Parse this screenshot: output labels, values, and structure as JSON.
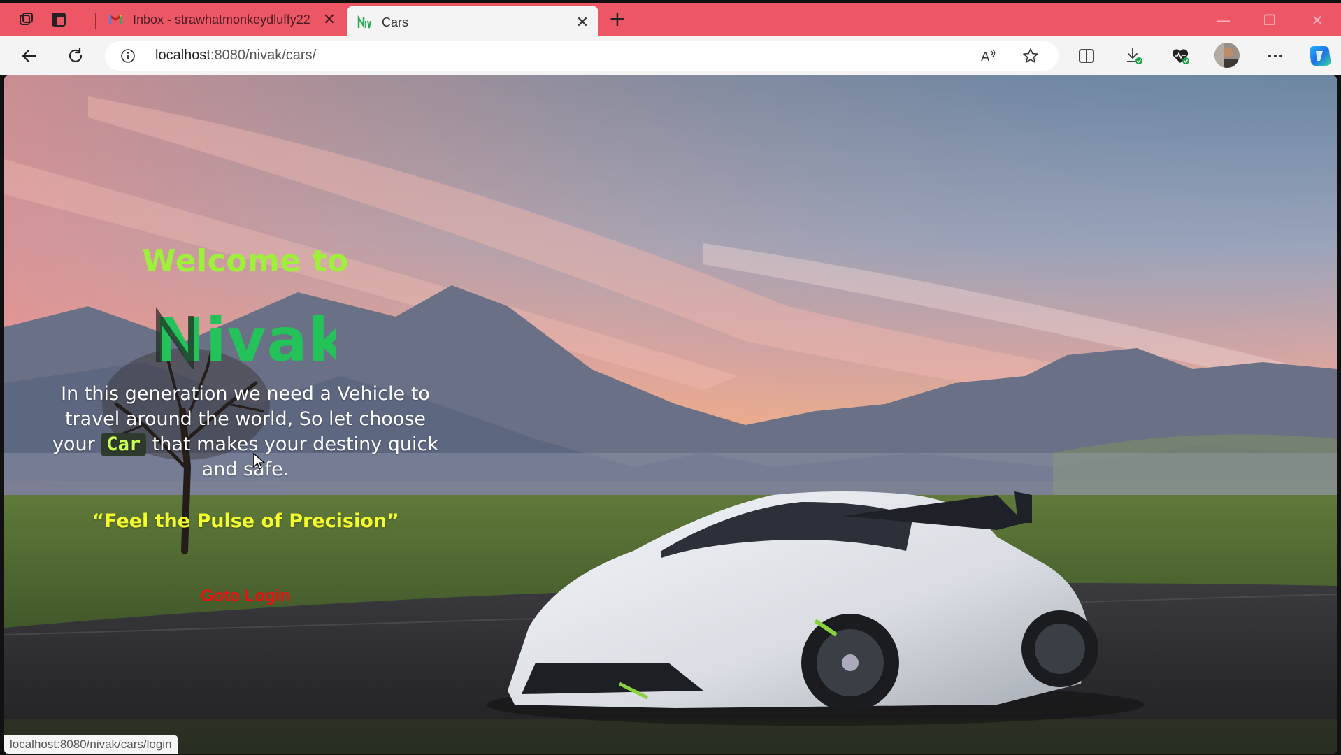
{
  "browser": {
    "tabs": [
      {
        "title": "Inbox - strawhatmonkeydluffy22",
        "active": false,
        "icon": "gmail-icon"
      },
      {
        "title": "Cars",
        "active": true,
        "icon": "nivak-favicon"
      }
    ],
    "new_tab_symbol": "+",
    "close_symbol": "✕",
    "window_controls": {
      "minimize": "—",
      "restore": "❐",
      "close": "✕"
    },
    "url": {
      "host": "localhost",
      "path": ":8080/nivak/cars/"
    },
    "toolbar_icons": [
      "read-aloud-icon",
      "favorite-star-icon",
      "split-screen-icon",
      "downloads-icon",
      "browser-essentials-icon",
      "profile-avatar",
      "more-icon",
      "copilot-icon"
    ]
  },
  "page": {
    "welcome": "Welcome to",
    "logo_text": "Nivak",
    "description_before": "In this generation we need a Vehicle to travel around the world, So let choose your",
    "description_highlight": "Car",
    "description_after": "that makes your destiny quick and safe.",
    "quote": "“Feel the Pulse of Precision”",
    "goto_login": "Goto Login"
  },
  "status_bar": {
    "hover_url": "localhost:8080/nivak/cars/login"
  },
  "colors": {
    "tabbar": "#ec5665",
    "welcome": "#9ff03b",
    "logo_green": "#23c35a",
    "highlight": "#c9ff52",
    "quote": "#f6ff2e",
    "link": "#e8110f"
  }
}
